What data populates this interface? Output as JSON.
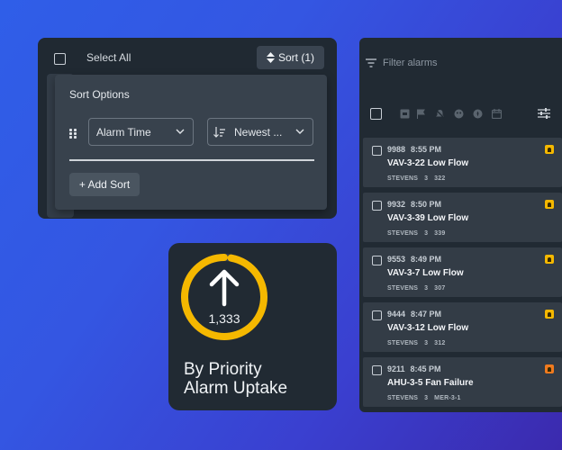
{
  "sort_panel": {
    "select_all_label": "Select All",
    "sort_button_label": "Sort (1)",
    "popover_title": "Sort Options",
    "criteria": [
      {
        "field": "Alarm Time",
        "order": "Newest ..."
      }
    ],
    "add_sort_label": "+ Add Sort"
  },
  "uptake": {
    "count": "1,333",
    "title_line1": "By Priority",
    "title_line2": "Alarm Uptake",
    "ring_color": "#f5b800",
    "ring_fill_fraction": 0.97
  },
  "alarm_list": {
    "filter_placeholder": "Filter alarms",
    "toolbar_icons": [
      "archive-icon",
      "flag-icon",
      "mute-icon",
      "face-icon",
      "badge-icon",
      "calendar-icon",
      "settings-sliders-icon"
    ],
    "alarms": [
      {
        "id": "9988",
        "time": "8:55 PM",
        "name": "VAV-3-22 Low Flow",
        "site": "STEVENS",
        "floor": "3",
        "room": "322",
        "priority_color": "#f5b800"
      },
      {
        "id": "9932",
        "time": "8:50 PM",
        "name": "VAV-3-39 Low Flow",
        "site": "STEVENS",
        "floor": "3",
        "room": "339",
        "priority_color": "#f5b800"
      },
      {
        "id": "9553",
        "time": "8:49 PM",
        "name": "VAV-3-7 Low Flow",
        "site": "STEVENS",
        "floor": "3",
        "room": "307",
        "priority_color": "#f5b800"
      },
      {
        "id": "9444",
        "time": "8:47 PM",
        "name": "VAV-3-12 Low Flow",
        "site": "STEVENS",
        "floor": "3",
        "room": "312",
        "priority_color": "#f5b800"
      },
      {
        "id": "9211",
        "time": "8:45 PM",
        "name": "AHU-3-5 Fan Failure",
        "site": "STEVENS",
        "floor": "3",
        "room": "MER-3-1",
        "priority_color": "#f07a1e"
      }
    ]
  }
}
